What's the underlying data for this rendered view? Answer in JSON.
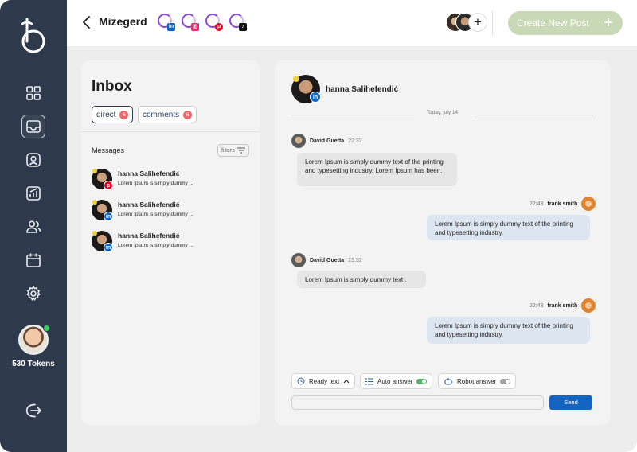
{
  "colors": {
    "sidebar": "#2e3a4b",
    "accent_button": "#c9d8b6",
    "send_button": "#1564c0",
    "badge": "#f06767",
    "online": "#2fd35a"
  },
  "header": {
    "brand": "Mizegerd",
    "socials": [
      {
        "icon": "linkedin-icon",
        "glyph": "in",
        "color": "#0a66c2"
      },
      {
        "icon": "instagram-icon",
        "glyph": "◎",
        "color": "#e1306c"
      },
      {
        "icon": "pinterest-icon",
        "glyph": "p",
        "color": "#e60023"
      },
      {
        "icon": "tiktok-icon",
        "glyph": "♪",
        "color": "#111111"
      }
    ],
    "add_member": "+",
    "create_post": "Create New Post",
    "create_plus": "+"
  },
  "sidebar": {
    "tokens": "530 Tokens",
    "nav": [
      "dashboard-icon",
      "inbox-icon",
      "profile-icon",
      "analytics-icon",
      "users-icon",
      "calendar-icon",
      "settings-icon"
    ],
    "active": "inbox-icon"
  },
  "inbox": {
    "title": "Inbox",
    "tabs": [
      {
        "label": "direct",
        "count": "6"
      },
      {
        "label": "comments",
        "count": "6"
      }
    ],
    "messages_label": "Messages",
    "filters_label": "filters",
    "conversations": [
      {
        "name": "hanna Salihefendić",
        "preview": "Lorem Ipsum is simply dummy ...",
        "network": "pinterest",
        "glyph": "p",
        "color": "#e60023"
      },
      {
        "name": "hanna Salihefendić",
        "preview": "Lorem Ipsum is simply dummy ...",
        "network": "linkedin",
        "glyph": "in",
        "color": "#0a66c2"
      },
      {
        "name": "hanna Salihefendić",
        "preview": "Lorem Ipsum is simply dummy ...",
        "network": "linkedin",
        "glyph": "in",
        "color": "#0a66c2"
      }
    ]
  },
  "chat": {
    "contact": "hanna Salihefendić",
    "contact_network_glyph": "in",
    "date": "Today, july 14",
    "messages": [
      {
        "sender": "David Guetta",
        "time": "22:32",
        "text": "Lorem Ipsum is simply dummy text of the printing and typesetting industry. Lorem Ipsum has been."
      },
      {
        "sender": "frank smith",
        "time": "22:43",
        "text": "Lorem Ipsum is simply dummy text of the printing and typesetting industry."
      },
      {
        "sender": "David Guetta",
        "time": "23:32",
        "text": "Lorem Ipsum is simply dummy text ."
      },
      {
        "sender": "frank smith",
        "time": "22:43",
        "text": "Lorem Ipsum is simply dummy text of the printing and typesetting industry."
      }
    ],
    "tools": {
      "ready_text": "Ready text",
      "auto_answer": "Auto answer",
      "auto_answer_on": true,
      "robot_answer": "Robot answer",
      "robot_answer_on": false
    },
    "input_placeholder": "",
    "send_label": "Send"
  }
}
